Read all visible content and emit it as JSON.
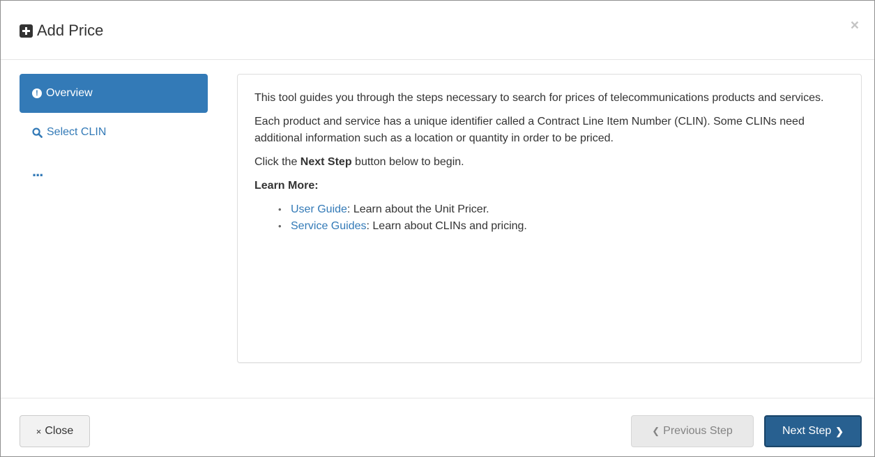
{
  "modal": {
    "title": "Add Price",
    "close_glyph": "×"
  },
  "sidebar": {
    "items": [
      {
        "label": "Overview",
        "icon": "exclamation-circle-icon",
        "active": true
      },
      {
        "label": "Select CLIN",
        "icon": "search-icon",
        "active": false
      },
      {
        "label": "...",
        "icon": "ellipsis",
        "active": false
      }
    ]
  },
  "content": {
    "p1": "This tool guides you through the steps necessary to search for prices of telecommunications products and services.",
    "p2": "Each product and service has a unique identifier called a Contract Line Item Number (CLIN). Some CLINs need additional information such as a location or quantity in order to be priced.",
    "p3_prefix": "Click the ",
    "p3_bold": "Next Step",
    "p3_suffix": " button below to begin.",
    "learn_more": "Learn More:",
    "links": [
      {
        "link_text": "User Guide",
        "desc": ": Learn about the Unit Pricer."
      },
      {
        "link_text": "Service Guides",
        "desc": ": Learn about CLINs and pricing."
      }
    ]
  },
  "footer": {
    "close_icon": "×",
    "close_label": "Close",
    "prev_icon": "❮",
    "prev_label": "Previous Step",
    "next_label": "Next Step",
    "next_icon": "❯"
  },
  "colors": {
    "primary": "#337ab7",
    "primary_dark": "#286090",
    "text": "#333333"
  }
}
